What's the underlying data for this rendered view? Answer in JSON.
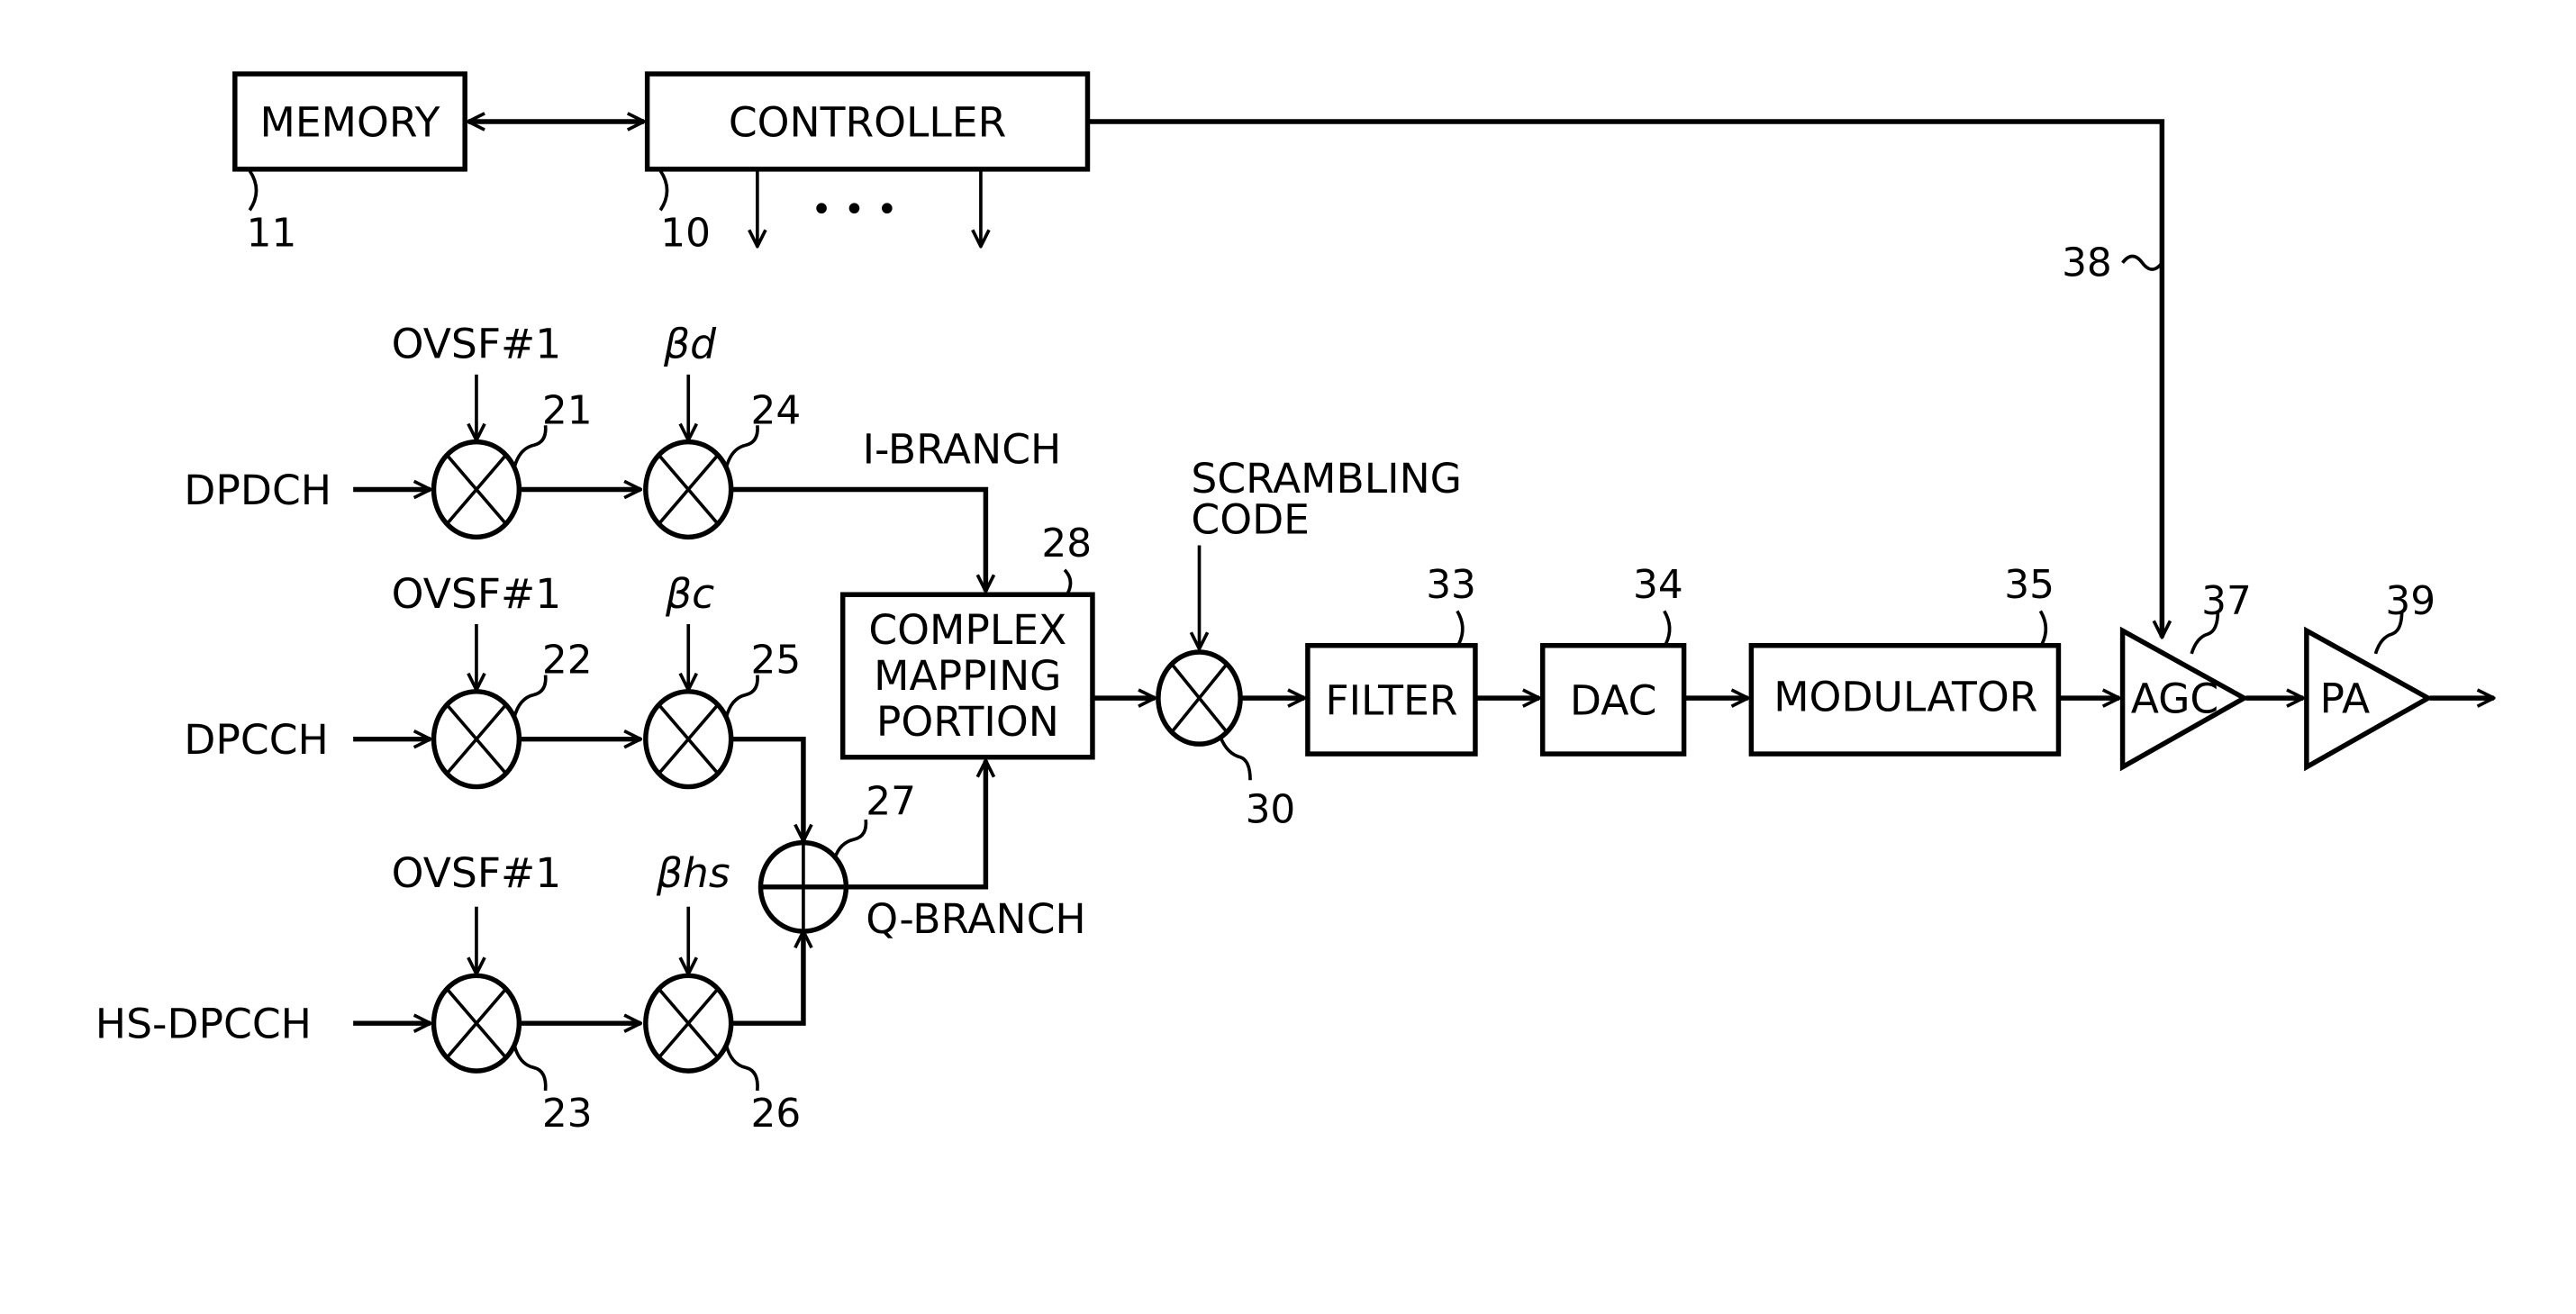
{
  "blocks": {
    "memory": {
      "label": "MEMORY",
      "ref": "11"
    },
    "controller": {
      "label": "CONTROLLER",
      "ref": "10"
    },
    "complex_mapping": {
      "lines": [
        "COMPLEX",
        "MAPPING",
        "PORTION"
      ],
      "ref": "28"
    },
    "filter": {
      "label": "FILTER",
      "ref": "33"
    },
    "dac": {
      "label": "DAC",
      "ref": "34"
    },
    "modulator": {
      "label": "MODULATOR",
      "ref": "35"
    },
    "agc": {
      "label": "AGC",
      "ref": "37"
    },
    "pa": {
      "label": "PA",
      "ref": "39"
    }
  },
  "controller_outputs_ellipsis": "• • •",
  "control_line_ref": "38",
  "channels": [
    {
      "name": "DPDCH",
      "spread_code": "OVSF#1",
      "gain": "βd",
      "spreader_ref": "21",
      "gain_ref": "24"
    },
    {
      "name": "DPCCH",
      "spread_code": "OVSF#1",
      "gain": "βc",
      "spreader_ref": "22",
      "gain_ref": "25"
    },
    {
      "name": "HS-DPCCH",
      "spread_code": "OVSF#1",
      "gain": "βhs",
      "spreader_ref": "23",
      "gain_ref": "26"
    }
  ],
  "adder_ref": "27",
  "i_branch_label": "I-BRANCH",
  "q_branch_label": "Q-BRANCH",
  "scrambling": {
    "lines": [
      "SCRAMBLING",
      "CODE"
    ],
    "ref": "30"
  }
}
